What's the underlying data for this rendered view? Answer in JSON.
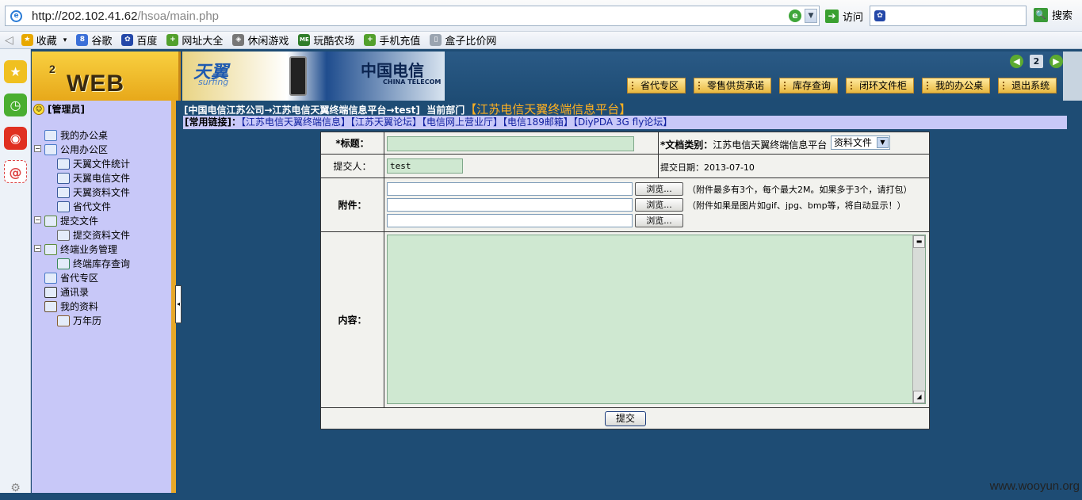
{
  "browser": {
    "url_host": "http://202.102.41.62",
    "url_path": "/hsoa/main.php",
    "go_label": "访问",
    "search_label": "搜索"
  },
  "favorites": [
    {
      "label": "收藏",
      "icon": "star-icon",
      "color": "#e8a800"
    },
    {
      "label": "谷歌",
      "icon": "google-icon",
      "color": "#3a6fd8"
    },
    {
      "label": "百度",
      "icon": "baidu-paw-icon",
      "color": "#2347a8"
    },
    {
      "label": "网址大全",
      "icon": "green-plus-icon",
      "color": "#52a02c"
    },
    {
      "label": "休闲游戏",
      "icon": "gamepad-icon",
      "color": "#777777"
    },
    {
      "label": "玩酷农场",
      "icon": "me-icon",
      "color": "#2f7d2a"
    },
    {
      "label": "手机充值",
      "icon": "green-plus-icon",
      "color": "#52a02c"
    },
    {
      "label": "盒子比价网",
      "icon": "page-icon",
      "color": "#9aa4b0"
    }
  ],
  "app": {
    "logo_text": "WEB OA",
    "logo_sup": "2",
    "banner_brand": "天翼",
    "banner_sub": "surfing",
    "banner_telecom": "中国电信",
    "banner_telecom_en": "CHINA TELECOM",
    "top_menu": [
      "省代专区",
      "零售供货承诺",
      "库存查询",
      "闭环文件柜",
      "我的办公桌",
      "退出系统"
    ]
  },
  "sidebar": {
    "user": "[管理员]",
    "items": [
      {
        "label": "我的办公桌"
      },
      {
        "label": "公用办公区"
      },
      {
        "label": "天翼文件统计"
      },
      {
        "label": "天翼电信文件"
      },
      {
        "label": "天翼资料文件"
      },
      {
        "label": "省代文件"
      },
      {
        "label": "提交文件"
      },
      {
        "label": "提交资料文件"
      },
      {
        "label": "终端业务管理"
      },
      {
        "label": "终端库存查询"
      },
      {
        "label": "省代专区"
      },
      {
        "label": "通讯录"
      },
      {
        "label": "我的资料"
      },
      {
        "label": "万年历"
      }
    ]
  },
  "breadcrumb": {
    "path": "[中国电信江苏公司→江苏电信天翼终端信息平台→test]",
    "dept_label": "当前部门",
    "dept_value": "【江苏电信天翼终端信息平台】"
  },
  "quick_links": {
    "label": "[常用链接]：",
    "items": [
      "【江苏电信天翼终端信息】",
      "【江苏天翼论坛】",
      "【电信网上营业厅】",
      "【电信189邮箱】",
      "【DiyPDA 3G fly论坛】"
    ]
  },
  "form": {
    "title_label": "*标题：",
    "title_value": "",
    "doctype_label": "*文档类别：",
    "doctype_text": "江苏电信天翼终端信息平台",
    "doctype_select": "资料文件",
    "submitter_label": "提交人：",
    "submitter_value": "test",
    "date_label": "提交日期：",
    "date_value": "2013-07-10",
    "attach_label": "附件：",
    "browse_label": "浏览...",
    "attach_note1": "（附件最多有3个，每个最大2M。如果多于3个，请打包）",
    "attach_note2": "（附件如果是图片如gif、jpg、bmp等，将自动显示！）",
    "content_label": "内容：",
    "content_value": "",
    "submit_label": "提交"
  },
  "watermark": "www.wooyun.org"
}
